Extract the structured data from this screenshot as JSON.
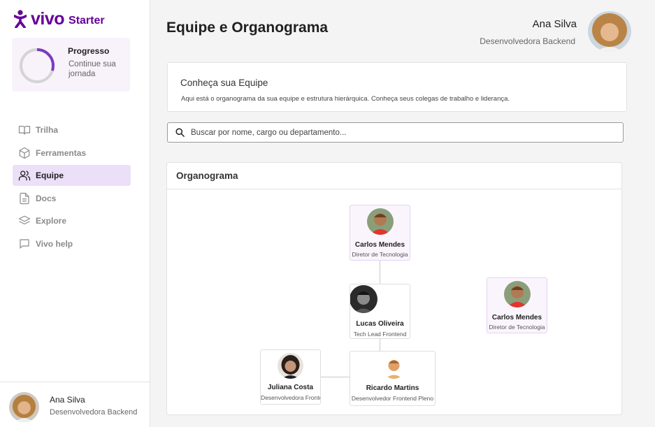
{
  "brand": {
    "name": "vivo",
    "product": "Starter",
    "color": "#660099"
  },
  "progress": {
    "title": "Progresso",
    "subtitle": "Continue sua jornada",
    "value": 0.3
  },
  "nav": [
    {
      "label": "Trilha",
      "icon": "book-icon",
      "active": false
    },
    {
      "label": "Ferramentas",
      "icon": "box-icon",
      "active": false
    },
    {
      "label": "Equipe",
      "icon": "users-icon",
      "active": true
    },
    {
      "label": "Docs",
      "icon": "document-icon",
      "active": false
    },
    {
      "label": "Explore",
      "icon": "layers-icon",
      "active": false
    },
    {
      "label": "Vivo help",
      "icon": "chat-icon",
      "active": false
    }
  ],
  "user": {
    "name": "Ana Silva",
    "role": "Desenvolvedora Backend"
  },
  "page": {
    "title": "Equipe e Organograma"
  },
  "intro": {
    "title": "Conheça sua Equipe",
    "text": "Aqui está o organograma da sua equipe e estrutura hierárquica. Conheça seus colegas de trabalho e liderança."
  },
  "search": {
    "placeholder": "Buscar por nome, cargo ou departamento...",
    "value": ""
  },
  "org": {
    "title": "Organograma",
    "nodes": [
      {
        "name": "Carlos Mendes",
        "role": "Diretor de Tecnologia"
      },
      {
        "name": "Lucas Oliveira",
        "role": "Tech Lead Frontend"
      },
      {
        "name": "Juliana Costa",
        "role": "Desenvolvedora Frontend Sênior"
      },
      {
        "name": "Ricardo Martins",
        "role": "Desenvolvedor Frontend Pleno"
      },
      {
        "name": "Carlos Mendes",
        "role": "Diretor de Tecnologia"
      }
    ]
  }
}
